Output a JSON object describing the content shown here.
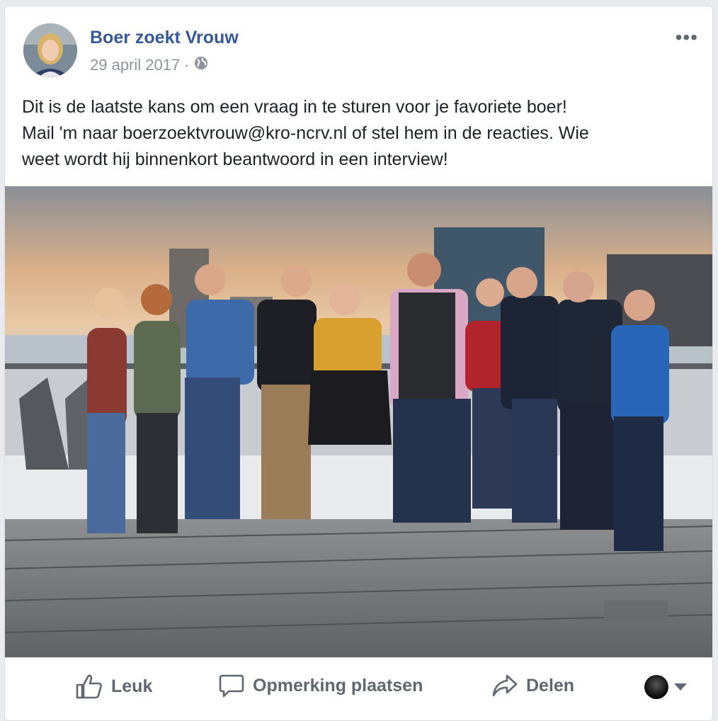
{
  "post": {
    "page_name": "Boer zoekt Vrouw",
    "date": "29 april 2017",
    "separator": "·",
    "privacy_icon": "globe-icon",
    "more_icon": "more-options-icon",
    "more_glyph": "•••",
    "text_lines": [
      "Dit is de laatste kans om een vraag in te sturen voor je favoriete boer!",
      "Mail 'm naar boerzoektvrouw@kro-ncrv.nl of stel hem in de reacties. Wie",
      "weet wordt hij binnenkort beantwoord in een interview!"
    ]
  },
  "actions": {
    "like_label": "Leuk",
    "comment_label": "Opmerking plaatsen",
    "share_label": "Delen",
    "like_icon": "thumbs-up-icon",
    "comment_icon": "speech-bubble-icon",
    "share_icon": "share-arrow-icon"
  },
  "colors": {
    "page_name": "#365899",
    "meta": "#90949c",
    "text": "#1d2129",
    "action": "#606770"
  }
}
